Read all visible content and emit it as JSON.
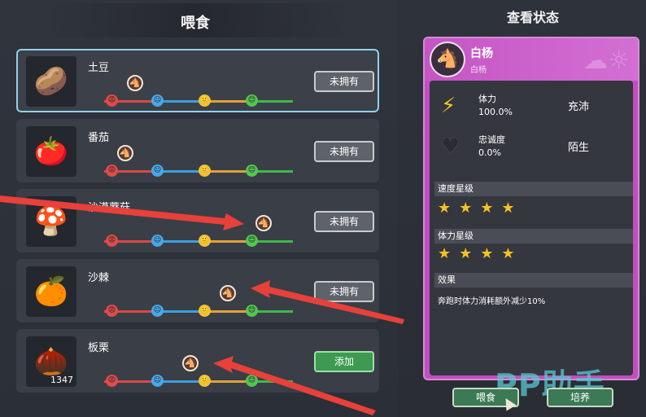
{
  "feed_panel": {
    "title": "喂食",
    "items": [
      {
        "name": "土豆",
        "icon": "🥔",
        "count": "",
        "button": "未拥有",
        "selected": true,
        "owned": false
      },
      {
        "name": "番茄",
        "icon": "🍅",
        "count": "",
        "button": "未拥有",
        "selected": false,
        "owned": false
      },
      {
        "name": "沙漠蘑菇",
        "icon": "🍄",
        "count": "",
        "button": "未拥有",
        "selected": false,
        "owned": false
      },
      {
        "name": "沙棘",
        "icon": "🍊",
        "count": "",
        "button": "未拥有",
        "selected": false,
        "owned": false
      },
      {
        "name": "板栗",
        "icon": "🌰",
        "count": "1347",
        "button": "添加",
        "selected": false,
        "owned": true
      }
    ],
    "mood_faces": [
      "😡",
      "😐",
      "🙂",
      "😊"
    ]
  },
  "status_panel": {
    "title": "查看状态",
    "horse_name": "白杨",
    "horse_subtitle": "白杨",
    "stamina_label": "体力",
    "stamina_value": "100.0%",
    "stamina_state": "充沛",
    "loyalty_label": "忠诚度",
    "loyalty_value": "0.0%",
    "loyalty_state": "陌生",
    "speed_stars_label": "速度星级",
    "speed_stars": "★★★★",
    "stamina_stars_label": "体力星级",
    "stamina_stars": "★★★★",
    "effect_label": "效果",
    "effect_text": "奔跑时体力消耗额外减少10%"
  },
  "actions": {
    "feed": "喂食",
    "train": "培养"
  },
  "watermark": "PP助手",
  "colors": {
    "accent_purple": "#c04fc0",
    "selected_border": "#8fd0ea",
    "add_green": "#3d9a50",
    "star": "#f5c320",
    "arrow": "#e8403a"
  }
}
